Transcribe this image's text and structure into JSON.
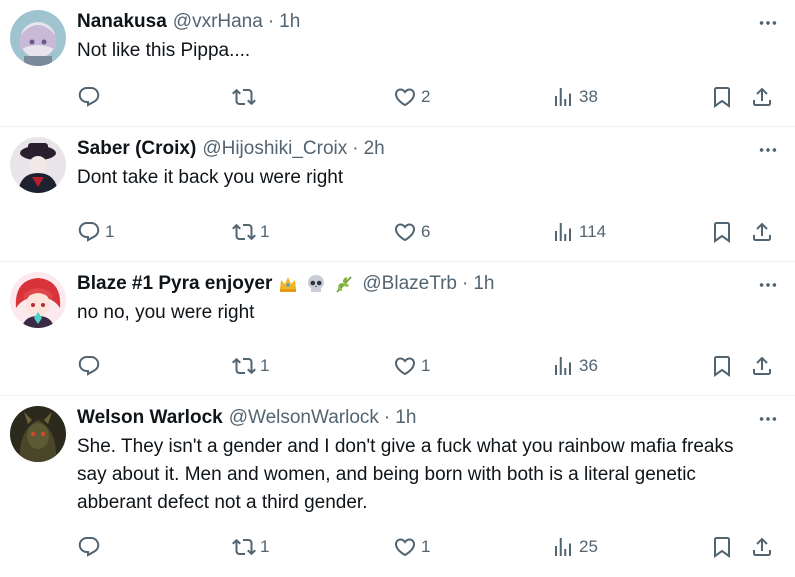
{
  "tweets": [
    {
      "name": "Nanakusa",
      "handle": "@vxrHana",
      "sep": "·",
      "time": "1h",
      "text": "Not like this Pippa....",
      "replies": "",
      "retweets": "",
      "likes": "2",
      "views": "38",
      "avatar_color": "#b6c7d2"
    },
    {
      "name": "Saber (Croix)",
      "handle": "@Hijoshiki_Croix",
      "sep": "·",
      "time": "2h",
      "text": "Dont take it back you were right",
      "replies": "1",
      "retweets": "1",
      "likes": "6",
      "views": "114",
      "avatar_color": "#2a2330"
    },
    {
      "name": "Blaze #1 Pyra enjoyer",
      "emojis": [
        "crown-icon",
        "skull-icon",
        "branch-icon"
      ],
      "handle": "@BlazeTrb",
      "sep": "·",
      "time": "1h",
      "text": "no no, you were right",
      "replies": "",
      "retweets": "1",
      "likes": "1",
      "views": "36",
      "avatar_color": "#d93a3a"
    },
    {
      "name": "Welson Warlock",
      "handle": "@WelsonWarlock",
      "sep": "·",
      "time": "1h",
      "text": "She. They isn't a gender and I don't give a fuck what you rainbow mafia freaks say about it. Men and women, and being born with both is a literal genetic abberant defect not a third gender.",
      "replies": "",
      "retweets": "1",
      "likes": "1",
      "views": "25",
      "avatar_color": "#3b3a25"
    }
  ],
  "colors": {
    "text_primary": "#0f1419",
    "text_secondary": "#536471",
    "divider": "#eff3f4"
  }
}
